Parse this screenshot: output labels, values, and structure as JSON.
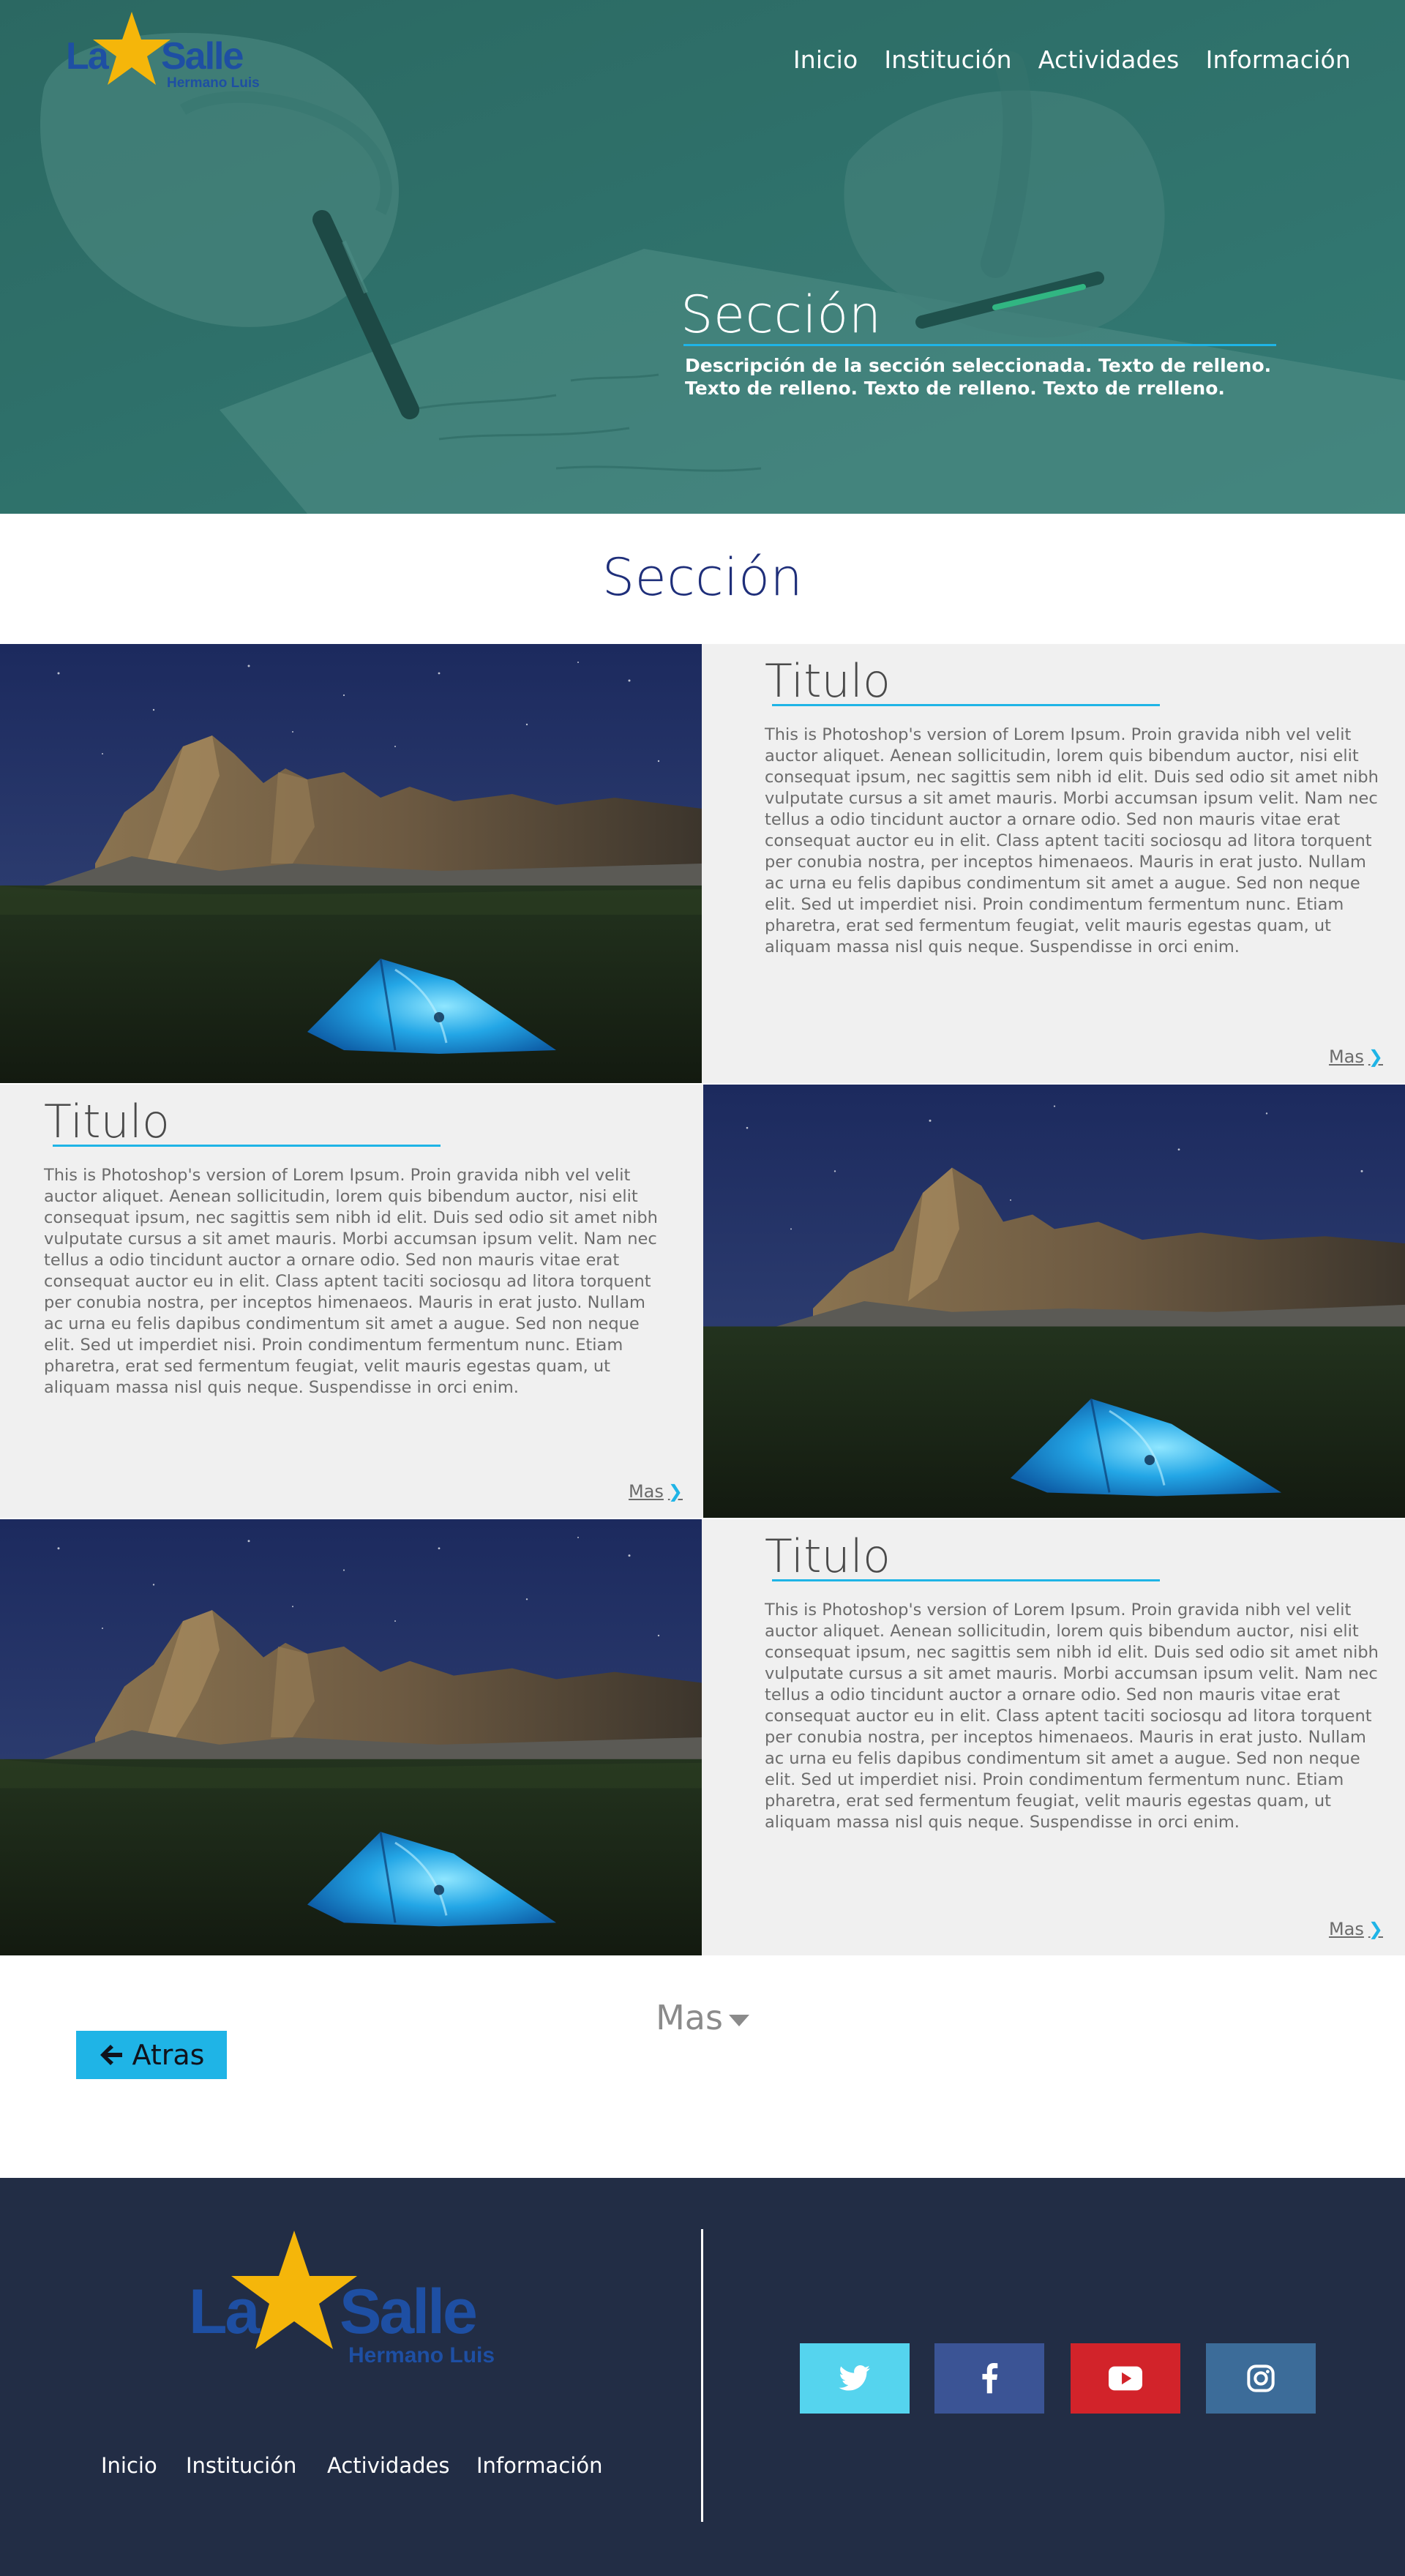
{
  "brand": {
    "logo_word": "La Salle",
    "logo_sub": "Hermano Luis",
    "color_blue": "#1e4fa3",
    "color_star": "#f5b60a"
  },
  "nav": {
    "items": [
      "Inicio",
      "Institución",
      "Actividades",
      "Información"
    ]
  },
  "hero": {
    "title": "Sección",
    "description": "Descripción de la sección seleccionada. Texto de relleno. Texto de relleno. Texto de relleno. Texto de rrelleno.",
    "overlay_color": "#2f6e68"
  },
  "section": {
    "heading": "Sección"
  },
  "rows": [
    {
      "title": "Titulo",
      "body": "This is Photoshop's version  of Lorem Ipsum. Proin gravida nibh vel velit auctor aliquet. Aenean sollicitudin, lorem quis bibendum auctor, nisi elit consequat ipsum, nec sagittis sem nibh id elit. Duis sed odio sit amet nibh vulputate cursus a sit amet mauris. Morbi accumsan ipsum velit. Nam nec tellus a odio tincidunt auctor a ornare odio. Sed non  mauris vitae erat consequat auctor eu in elit. Class aptent taciti sociosqu ad litora torquent per conubia nostra, per inceptos himenaeos. Mauris in erat justo. Nullam ac urna eu felis dapibus condimentum sit amet a augue. Sed non neque elit. Sed ut imperdiet nisi. Proin condimentum fermentum nunc. Etiam pharetra, erat sed fermentum feugiat, velit mauris egestas quam, ut aliquam massa nisl quis neque. Suspendisse in orci enim.",
      "more": "Mas"
    },
    {
      "title": "Titulo",
      "body": "This is Photoshop's version  of Lorem Ipsum. Proin gravida nibh vel velit auctor aliquet. Aenean sollicitudin, lorem quis bibendum auctor, nisi elit consequat ipsum, nec sagittis sem nibh id elit. Duis sed odio sit amet nibh vulputate cursus a sit amet mauris. Morbi accumsan ipsum velit. Nam nec tellus a odio tincidunt auctor a ornare odio. Sed non  mauris vitae erat consequat auctor eu in elit. Class aptent taciti sociosqu ad litora torquent per conubia nostra, per inceptos himenaeos. Mauris in erat justo. Nullam ac urna eu felis dapibus condimentum sit amet a augue. Sed non neque elit. Sed ut imperdiet nisi. Proin condimentum fermentum nunc. Etiam pharetra, erat sed fermentum feugiat, velit mauris egestas quam, ut aliquam massa nisl quis neque. Suspendisse in orci enim.",
      "more": "Mas"
    },
    {
      "title": "Titulo",
      "body": "This is Photoshop's version  of Lorem Ipsum. Proin gravida nibh vel velit auctor aliquet. Aenean sollicitudin, lorem quis bibendum auctor, nisi elit consequat ipsum, nec sagittis sem nibh id elit. Duis sed odio sit amet nibh vulputate cursus a sit amet mauris. Morbi accumsan ipsum velit. Nam nec tellus a odio tincidunt auctor a ornare odio. Sed non  mauris vitae erat consequat auctor eu in elit. Class aptent taciti sociosqu ad litora torquent per conubia nostra, per inceptos himenaeos. Mauris in erat justo. Nullam ac urna eu felis dapibus condimentum sit amet a augue. Sed non neque elit. Sed ut imperdiet nisi. Proin condimentum fermentum nunc. Etiam pharetra, erat sed fermentum feugiat, velit mauris egestas quam, ut aliquam massa nisl quis neque. Suspendisse in orci enim.",
      "more": "Mas"
    }
  ],
  "more_button": "Mas",
  "back_button": {
    "label": "Atras",
    "icon": "arrow-left-icon",
    "color": "#1fb4e6"
  },
  "footer": {
    "background": "#222d45",
    "nav": [
      "Inicio",
      "Institución",
      "Actividades",
      "Información"
    ],
    "social": [
      {
        "name": "twitter-icon",
        "color": "#55d4ee"
      },
      {
        "name": "facebook-icon",
        "color": "#3b5495"
      },
      {
        "name": "youtube-icon",
        "color": "#d2232a"
      },
      {
        "name": "instagram-icon",
        "color": "#3c6c99"
      }
    ]
  }
}
